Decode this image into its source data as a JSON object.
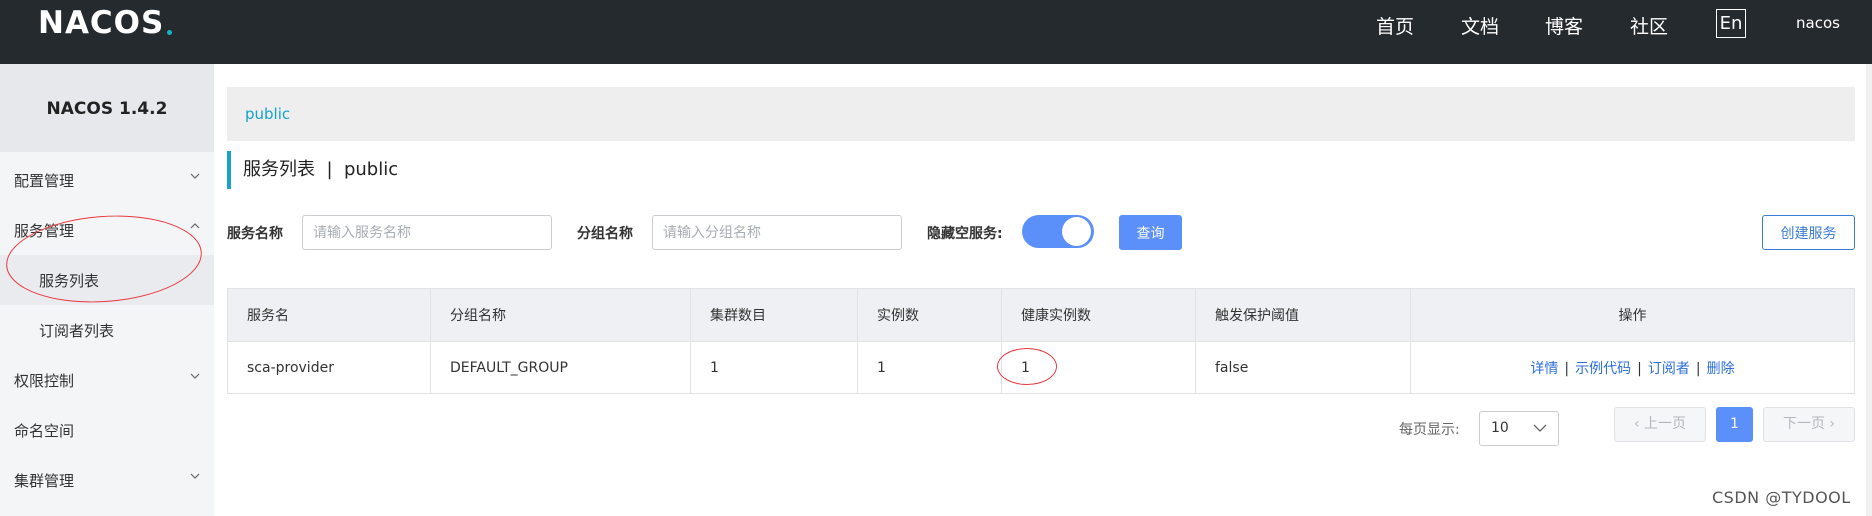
{
  "navbar": {
    "logo": "NACOS",
    "links": [
      "首页",
      "文档",
      "博客",
      "社区"
    ],
    "lang": "En",
    "user": "nacos"
  },
  "sidebar": {
    "title": "NACOS 1.4.2",
    "items": [
      {
        "label": "配置管理"
      },
      {
        "label": "服务管理"
      },
      {
        "label": "服务列表"
      },
      {
        "label": "订阅者列表"
      },
      {
        "label": "权限控制"
      },
      {
        "label": "命名空间"
      },
      {
        "label": "集群管理"
      }
    ]
  },
  "main": {
    "namespace_tab": "public",
    "page_title": "服务列表  |  public",
    "filters": {
      "service_name_label": "服务名称",
      "service_name_placeholder": "请输入服务名称",
      "group_name_label": "分组名称",
      "group_name_placeholder": "请输入分组名称",
      "hide_empty_label": "隐藏空服务:",
      "hide_empty_on": true,
      "query_button": "查询",
      "create_button": "创建服务"
    },
    "table": {
      "headers": [
        "服务名",
        "分组名称",
        "集群数目",
        "实例数",
        "健康实例数",
        "触发保护阈值",
        "操作"
      ],
      "rows": [
        {
          "service": "sca-provider",
          "group": "DEFAULT_GROUP",
          "clusters": "1",
          "instances": "1",
          "healthy": "1",
          "threshold": "false",
          "actions": [
            "详情",
            "示例代码",
            "订阅者",
            "删除"
          ]
        }
      ]
    },
    "pagination": {
      "per_page_label": "每页显示:",
      "per_page_value": "10",
      "prev": "上一页",
      "current": "1",
      "next": "下一页"
    }
  },
  "watermark": "CSDN @TYDOOL",
  "colors": {
    "navbar_bg": "#252a2f",
    "accent": "#17a2c8",
    "primary": "#5b8ff9",
    "annotation": "#e8383d"
  }
}
